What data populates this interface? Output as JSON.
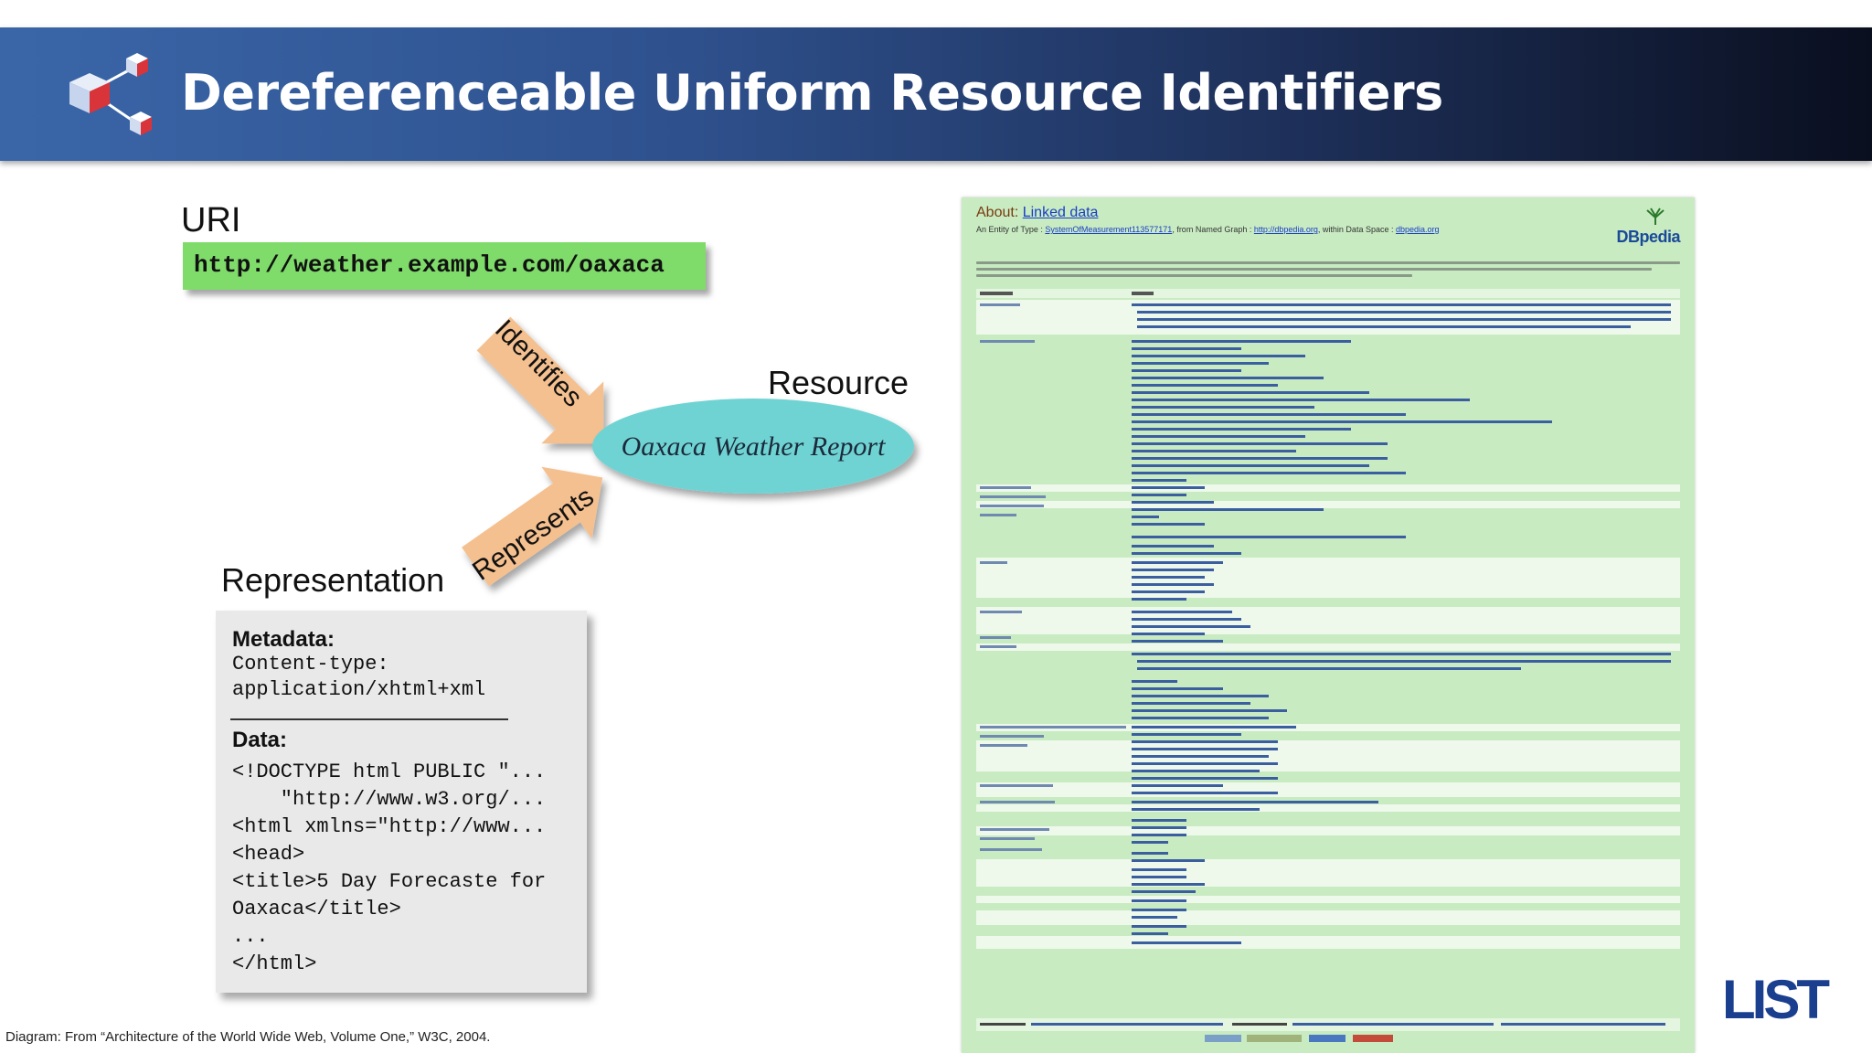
{
  "header": {
    "title": "Dereferenceable Uniform Resource Identifiers",
    "logo_icon": "linked-cubes-icon"
  },
  "diagram": {
    "uri_label": "URI",
    "uri_value": "http://weather.example.com/oaxaca",
    "identifies_label": "Identifies",
    "resource_label": "Resource",
    "resource_name": "Oaxaca Weather Report",
    "represents_label": "Represents",
    "representation_label": "Representation",
    "metadata_heading": "Metadata:",
    "metadata_lines": [
      "Content-type:",
      "application/xhtml+xml"
    ],
    "data_heading": "Data:",
    "data_lines": [
      "<!DOCTYPE html PUBLIC \"...",
      "    \"http://www.w3.org/...",
      "<html xmlns=\"http://www...",
      "<head>",
      "<title>5 Day Forecaste for",
      "Oaxaca</title>",
      "...",
      "</html>"
    ],
    "colors": {
      "uri_box": "#7fdc6a",
      "arrow": "#f5c08f",
      "ellipse": "#6fd3d3",
      "box": "#e9e9e9"
    }
  },
  "dbpedia_page": {
    "about_prefix": "About:",
    "about_link": "Linked data",
    "entity_text_1": "An Entity of Type :",
    "entity_type": "SystemOfMeasurement113577171",
    "entity_text_2": ", from Named Graph :",
    "named_graph": "http://dbpedia.org",
    "entity_text_3": ", within Data Space :",
    "data_space": "dbpedia.org",
    "logo_text": "DBpedia",
    "colors": {
      "background": "#c8ebc1",
      "link": "#1a3ec8",
      "about": "#7a3a10"
    }
  },
  "caption": "Diagram: From “Architecture of the World Wide Web, Volume One,” W3C, 2004.",
  "branding": {
    "logo_text": "LIST",
    "logo_color": "#1b3f8f"
  }
}
